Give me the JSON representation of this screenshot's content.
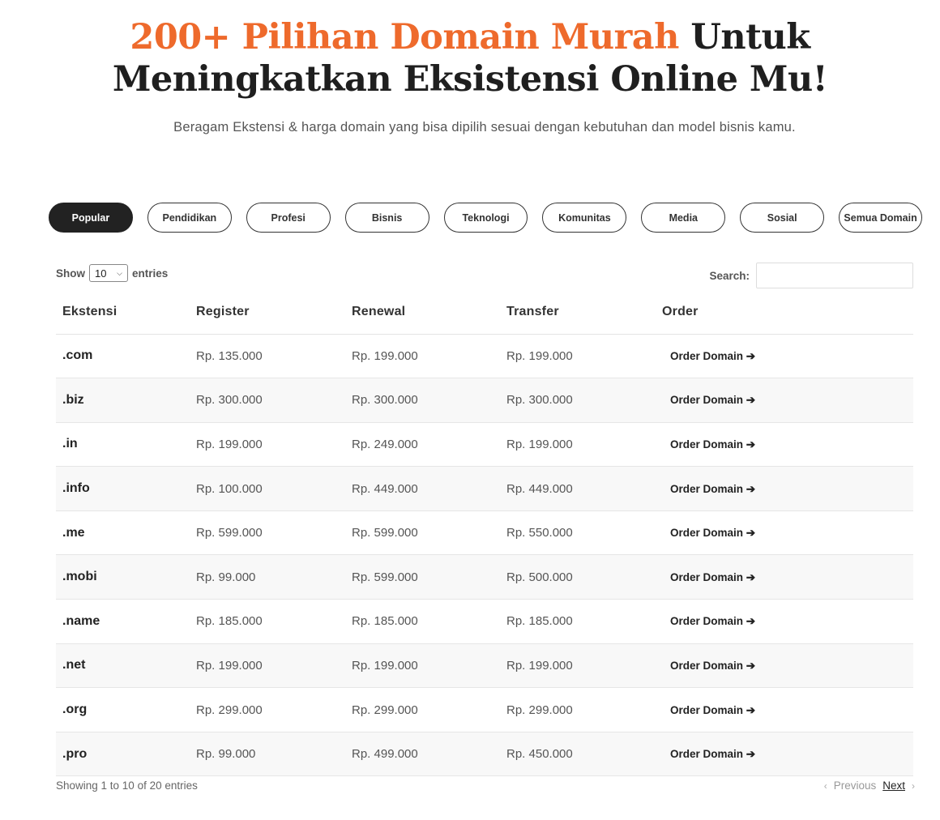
{
  "hero": {
    "title_accent": "200+ Pilihan Domain Murah",
    "title_rest_1": " Untuk",
    "title_line_2": "Meningkatkan Eksistensi Online Mu!",
    "subtitle": "Beragam Ekstensi & harga domain yang bisa dipilih sesuai dengan kebutuhan dan model bisnis kamu."
  },
  "tabs": [
    {
      "label": "Popular",
      "active": true
    },
    {
      "label": "Pendidikan"
    },
    {
      "label": "Profesi"
    },
    {
      "label": "Bisnis"
    },
    {
      "label": "Teknologi"
    },
    {
      "label": "Komunitas"
    },
    {
      "label": "Media"
    },
    {
      "label": "Sosial"
    },
    {
      "label": "Semua Domain"
    }
  ],
  "controls": {
    "show_label": "Show",
    "page_length": "10",
    "entries_label": "entries",
    "search_label": "Search:",
    "search_value": ""
  },
  "table": {
    "headers": [
      "Ekstensi",
      "Register",
      "Renewal",
      "Transfer",
      "Order"
    ],
    "order_label": "Order Domain ➔",
    "rows": [
      {
        "ext": ".com",
        "register": "Rp. 135.000",
        "renewal": "Rp. 199.000",
        "transfer": "Rp. 199.000"
      },
      {
        "ext": ".biz",
        "register": "Rp. 300.000",
        "renewal": "Rp. 300.000",
        "transfer": "Rp. 300.000"
      },
      {
        "ext": ".in",
        "register": "Rp. 199.000",
        "renewal": "Rp. 249.000",
        "transfer": "Rp. 199.000"
      },
      {
        "ext": ".info",
        "register": "Rp. 100.000",
        "renewal": "Rp. 449.000",
        "transfer": "Rp. 449.000"
      },
      {
        "ext": ".me",
        "register": "Rp. 599.000",
        "renewal": "Rp. 599.000",
        "transfer": "Rp. 550.000"
      },
      {
        "ext": ".mobi",
        "register": "Rp. 99.000",
        "renewal": "Rp. 599.000",
        "transfer": "Rp. 500.000"
      },
      {
        "ext": ".name",
        "register": "Rp. 185.000",
        "renewal": "Rp. 185.000",
        "transfer": "Rp. 185.000"
      },
      {
        "ext": ".net",
        "register": "Rp. 199.000",
        "renewal": "Rp. 199.000",
        "transfer": "Rp. 199.000"
      },
      {
        "ext": ".org",
        "register": "Rp. 299.000",
        "renewal": "Rp. 299.000",
        "transfer": "Rp. 299.000"
      },
      {
        "ext": ".pro",
        "register": "Rp. 99.000",
        "renewal": "Rp. 499.000",
        "transfer": "Rp. 450.000"
      }
    ]
  },
  "footer": {
    "info": "Showing 1 to 10 of 20 entries",
    "prev_label": "Previous",
    "next_label": "Next"
  }
}
